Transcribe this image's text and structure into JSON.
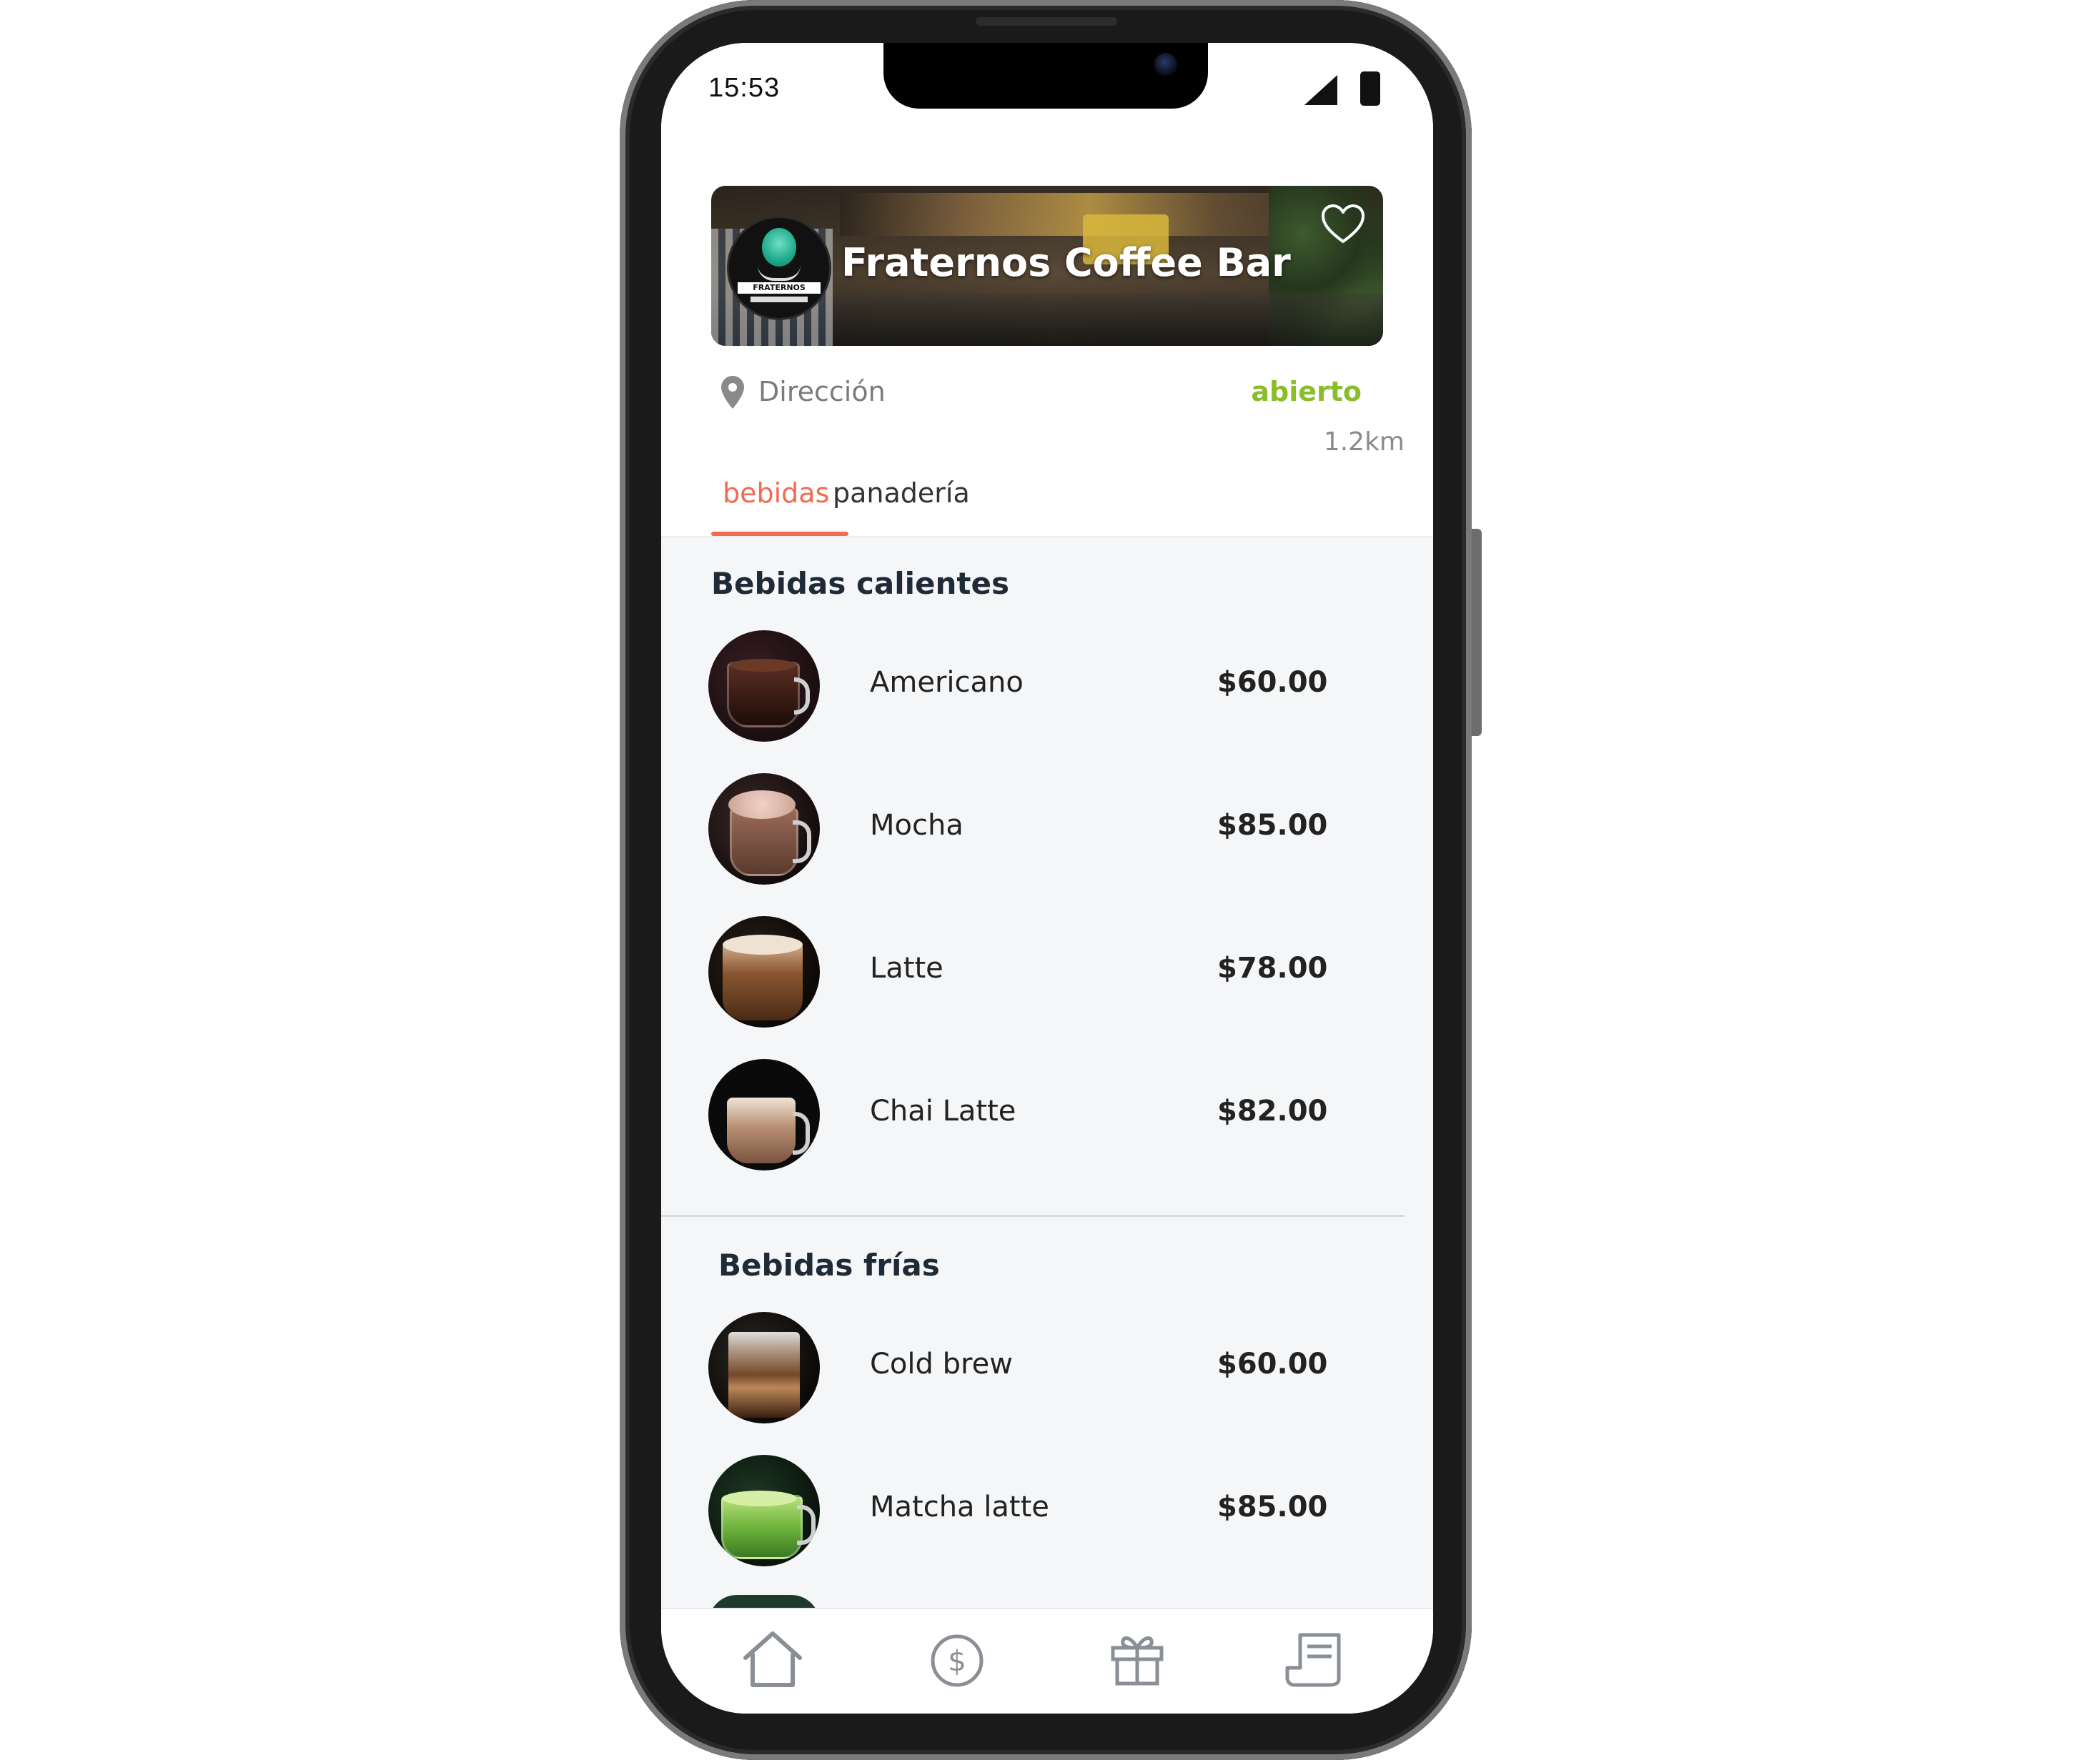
{
  "status_bar": {
    "time": "15:53"
  },
  "store": {
    "name": "Fraternos Coffee Bar",
    "logo_text": "FRATERNOS",
    "address_label": "Dirección",
    "open_status": "abierto",
    "distance": "1.2km"
  },
  "tabs": [
    {
      "label": "bebidas",
      "active": true
    },
    {
      "label": "panadería",
      "active": false
    }
  ],
  "sections": [
    {
      "title": "Bebidas calientes",
      "items": [
        {
          "name": "Americano",
          "price": "$60.00"
        },
        {
          "name": "Mocha",
          "price": "$85.00"
        },
        {
          "name": "Latte",
          "price": "$78.00"
        },
        {
          "name": "Chai Latte",
          "price": "$82.00"
        }
      ]
    },
    {
      "title": "Bebidas frías",
      "items": [
        {
          "name": "Cold brew",
          "price": "$60.00"
        },
        {
          "name": "Matcha latte",
          "price": "$85.00"
        }
      ]
    }
  ],
  "bottom_nav": [
    {
      "icon": "home-icon"
    },
    {
      "icon": "dollar-coin-icon"
    },
    {
      "icon": "gift-icon"
    },
    {
      "icon": "receipt-icon"
    }
  ],
  "colors": {
    "accent": "#f26a4f",
    "open": "#8abd2a",
    "text_dark": "#1f2a37"
  }
}
